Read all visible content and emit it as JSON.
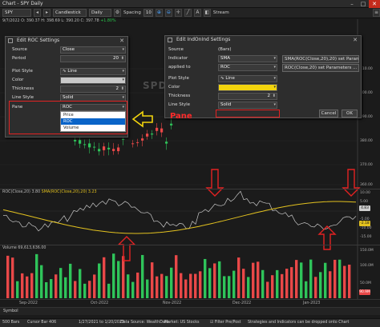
{
  "window": {
    "title": "Chart - SPY Daily"
  },
  "toolbar": {
    "symbol": "SPY",
    "chart_style": "Candlestick",
    "scale": "Daily",
    "spacing_label": "Spacing",
    "spacing_value": "10",
    "stream_label": "Stream"
  },
  "ohlc": {
    "date": "9/7/2022",
    "open": "O: 390.37",
    "high": "H: 398.69",
    "low": "L: 390.20",
    "close": "C: 397.78",
    "change": "+1.80%"
  },
  "chart": {
    "watermark": "SPD"
  },
  "price_axis": [
    "410.00",
    "400.00",
    "390.00",
    "380.00",
    "370.00",
    "360.00"
  ],
  "roc_pane": {
    "label": "ROC(Close,20)",
    "label_value": "3.80",
    "sma_label": "SMA(ROC(Close,20),20)",
    "sma_value": "3.23",
    "axis": [
      "10.00",
      "5.00",
      "0.00",
      "-5.00",
      "-10.00",
      "-15.00"
    ],
    "badge_roc": "4.83",
    "badge_sma": "-2.18"
  },
  "volume_pane": {
    "label": "Volume",
    "label_value": "69,613,636.00",
    "axis": [
      "150.0M",
      "100.0M",
      "50.0M"
    ],
    "badge": "90.9M"
  },
  "date_axis": [
    "Sep-2022",
    "Oct-2022",
    "Nov-2022",
    "Dec-2022",
    "Jan-2023"
  ],
  "lower_bar": {
    "symbol": "Symbol"
  },
  "status": {
    "bars": "500 Bars",
    "cursor_bar": "Cursor Bar 406",
    "date_range": "1/27/2021 to 1/20/2023",
    "data_source": "Data Source: WealthData",
    "market": "Market: US Stocks",
    "filter": "Filter Pre/Post",
    "hint": "Strategies and Indicators can be dropped onto Chart"
  },
  "roc_dialog": {
    "title": "Edit ROC Settings",
    "source_label": "Source",
    "source_value": "Close",
    "period_label": "Period",
    "period_value": "20",
    "plot_style_label": "Plot Style",
    "plot_style_value": "Line",
    "color_label": "Color",
    "thickness_label": "Thickness",
    "thickness_value": "2",
    "line_style_label": "Line Style",
    "line_style_value": "Solid",
    "pane_label": "Pane",
    "pane_value": "ROC",
    "pane_options": [
      "Price",
      "ROC",
      "Volume"
    ],
    "pane_selected_index": 1
  },
  "indonind_dialog": {
    "title": "Edit IndOnInd Settings",
    "source_label": "Source",
    "source_value": "(Bars)",
    "indicator_label": "Indicator",
    "indicator_value": "SMA",
    "indicator_params": "SMA(ROC(Close,20),20) set Parameters ...",
    "applied_label": "applied to",
    "applied_value": "ROC",
    "applied_params": "ROC(Close,20) set Parameters ...",
    "plot_style_label": "Plot Style",
    "plot_style_value": "Line",
    "color_label": "Color",
    "thickness_label": "Thickness",
    "thickness_value": "2",
    "line_style_label": "Line Style",
    "line_style_value": "Solid",
    "pane_label": "Pane",
    "cancel_label": "Cancel",
    "ok_label": "OK"
  },
  "annotation": {
    "pane_text": "Pane"
  },
  "colors": {
    "up": "#2fc45a",
    "down": "#e94848",
    "sma": "#e3c21f",
    "roc": "#c9c9c9",
    "annotation_red": "#e32222",
    "highlight_yellow": "#f2d40d"
  }
}
